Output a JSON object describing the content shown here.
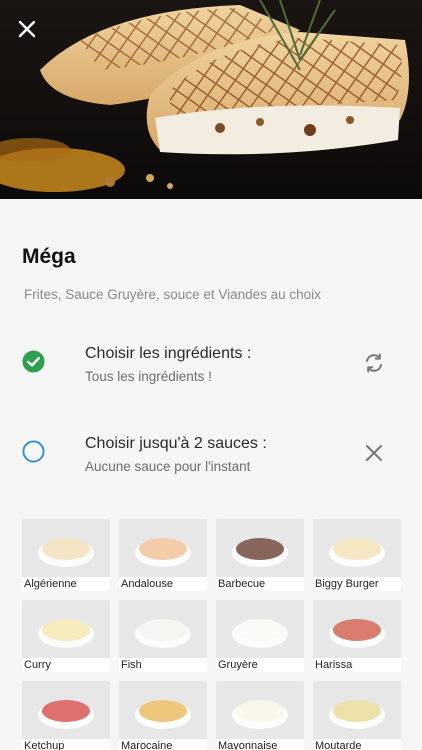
{
  "header": {
    "close_icon": "close-icon"
  },
  "product": {
    "name": "Méga",
    "description": "Frites, Sauce Gruyère, souce et Viandes au choix"
  },
  "options": [
    {
      "title": "Choisir les ingrédients :",
      "subtitle": "Tous les ingrédients !",
      "status_icon": "check-circle-icon",
      "action_icon": "refresh-icon",
      "status_color": "#2e9e4f"
    },
    {
      "title": "Choisir jusqu'à 2 sauces :",
      "subtitle": "Aucune sauce pour l'instant",
      "status_icon": "empty-circle-icon",
      "action_icon": "close-icon",
      "status_color": "#2b8fd6"
    }
  ],
  "sauces": [
    {
      "label": "Algérienne",
      "color": "#f0dcb0"
    },
    {
      "label": "Andalouse",
      "color": "#efb98a"
    },
    {
      "label": "Barbecue",
      "color": "#5a2a1c"
    },
    {
      "label": "Biggy Burger",
      "color": "#f2deaa"
    },
    {
      "label": "Curry",
      "color": "#f3e3a3"
    },
    {
      "label": "Fish",
      "color": "#f4f1ec"
    },
    {
      "label": "Gruyère",
      "color": "#faf7f2"
    },
    {
      "label": "Harissa",
      "color": "#c94a36"
    },
    {
      "label": "Ketchup",
      "color": "#d33a3a"
    },
    {
      "label": "Marocaine",
      "color": "#e9b24a"
    },
    {
      "label": "Mayonnaise",
      "color": "#f7f3e4"
    },
    {
      "label": "Moutarde",
      "color": "#e6d68a"
    }
  ]
}
